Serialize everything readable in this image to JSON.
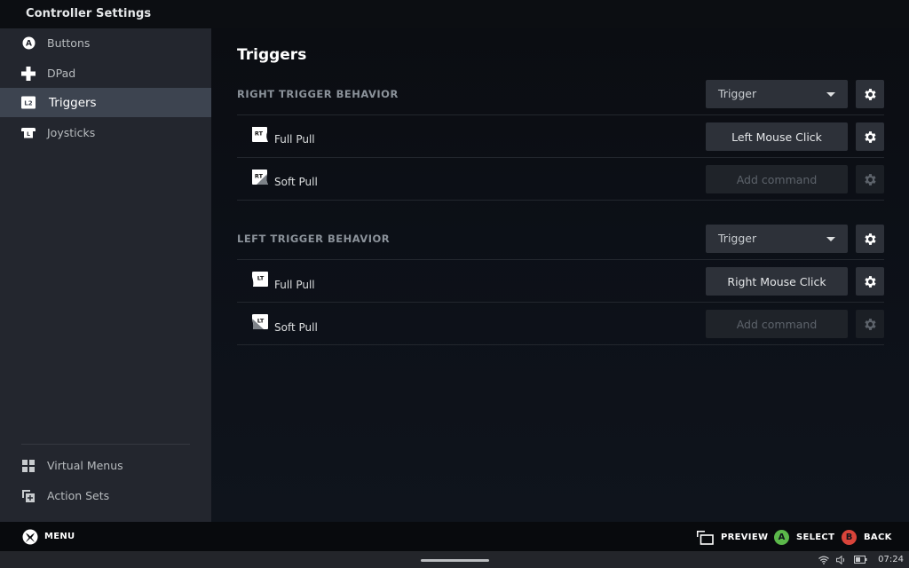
{
  "window": {
    "title": "Controller Settings"
  },
  "sidebar": {
    "items": [
      {
        "label": "Buttons",
        "icon": "a-button-icon",
        "active": false
      },
      {
        "label": "DPad",
        "icon": "dpad-icon",
        "active": false
      },
      {
        "label": "Triggers",
        "icon": "l2-trigger-icon",
        "active": true
      },
      {
        "label": "Joysticks",
        "icon": "joystick-icon",
        "active": false
      }
    ],
    "bottom_items": [
      {
        "label": "Virtual Menus",
        "icon": "grid-icon"
      },
      {
        "label": "Action Sets",
        "icon": "action-sets-icon"
      }
    ]
  },
  "main": {
    "title": "Triggers",
    "sections": [
      {
        "header": "RIGHT TRIGGER BEHAVIOR",
        "mode": "Trigger",
        "rows": [
          {
            "icon": "rt-full-pull-icon",
            "icon_text": "RT",
            "label": "Full Pull",
            "command": "Left Mouse Click",
            "empty": false
          },
          {
            "icon": "rt-soft-pull-icon",
            "icon_text": "RT",
            "label": "Soft Pull",
            "command": "Add command",
            "empty": true
          }
        ]
      },
      {
        "header": "LEFT TRIGGER BEHAVIOR",
        "mode": "Trigger",
        "rows": [
          {
            "icon": "lt-full-pull-icon",
            "icon_text": "LT",
            "label": "Full Pull",
            "command": "Right Mouse Click",
            "empty": false
          },
          {
            "icon": "lt-soft-pull-icon",
            "icon_text": "LT",
            "label": "Soft Pull",
            "command": "Add command",
            "empty": true
          }
        ]
      }
    ]
  },
  "footer": {
    "menu_label": "MENU",
    "hints": [
      {
        "label": "PREVIEW",
        "icon": "preview-icon"
      },
      {
        "label": "SELECT",
        "button": "A",
        "color": "#5bb84a"
      },
      {
        "label": "BACK",
        "button": "B",
        "color": "#d9443a"
      }
    ]
  },
  "taskbar": {
    "clock": "07:24",
    "tray_icons": [
      "wifi-icon",
      "volume-icon",
      "battery-icon"
    ]
  }
}
